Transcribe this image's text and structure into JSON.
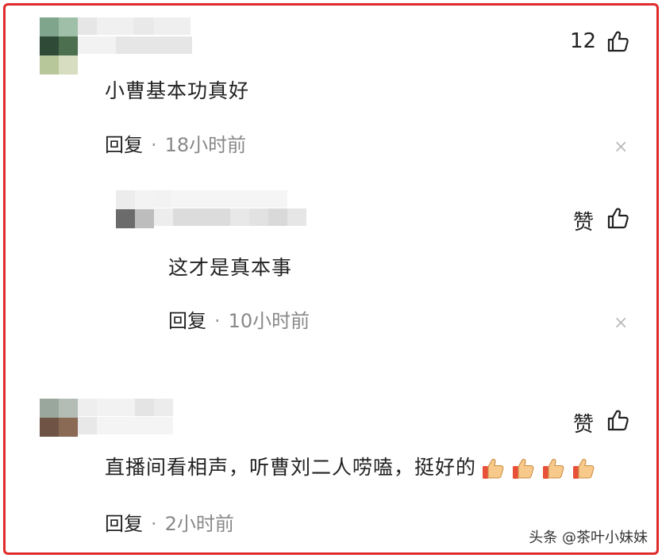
{
  "comments": [
    {
      "likes": "12",
      "text": "小曹基本功真好",
      "reply_label": "回复",
      "separator": "·",
      "time": "18小时前"
    },
    {
      "likes": "赞",
      "text": "这才是真本事",
      "reply_label": "回复",
      "separator": "·",
      "time": "10小时前"
    },
    {
      "likes": "赞",
      "text": "直播间看相声，听曹刘二人唠嗑，挺好的",
      "reply_label": "回复",
      "separator": "·",
      "time": "2小时前"
    }
  ],
  "close_glyph": "×",
  "watermark": "头条 @茶叶小妹妹",
  "icons": [
    "thumbs-up-icon",
    "close-icon",
    "thumbs-up-emoji-icon"
  ],
  "colors": {
    "border": "#e02b2b",
    "text": "#222222",
    "muted": "#888888"
  }
}
